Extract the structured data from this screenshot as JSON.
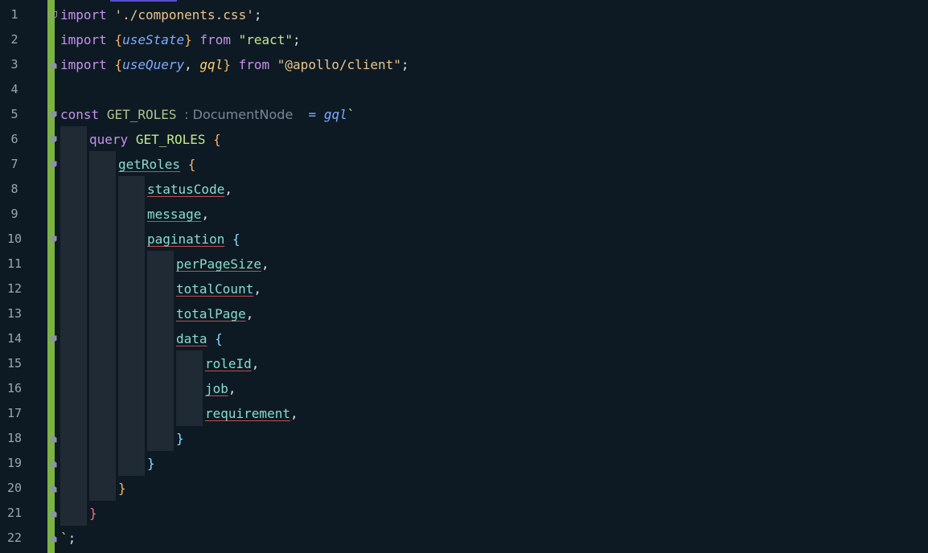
{
  "editor": {
    "line_numbers": [
      "1",
      "2",
      "3",
      "4",
      "5",
      "6",
      "7",
      "8",
      "9",
      "10",
      "11",
      "12",
      "13",
      "14",
      "15",
      "16",
      "17",
      "18",
      "19",
      "20",
      "21",
      "22"
    ],
    "lines": {
      "l1": {
        "kw": "import",
        "str": "'./components.css'",
        "end": ";"
      },
      "l2": {
        "kw": "import",
        "open": "{",
        "name": "useState",
        "close": "}",
        "from": "from",
        "str": "\"react\"",
        "end": ";"
      },
      "l3": {
        "kw": "import",
        "open": "{",
        "name1": "useQuery",
        "sep": ",",
        "name2": "gql",
        "close": "}",
        "from": "from",
        "str": "\"@apollo/client\"",
        "end": ";"
      },
      "l5": {
        "kw": "const",
        "ident": "GET_ROLES",
        "hint": ": DocumentNode",
        "eq": "=",
        "fn": "gql",
        "tick": "`"
      },
      "l6": {
        "kw": "query",
        "name": "GET_ROLES",
        "open": "{"
      },
      "l7": {
        "field": "getRoles",
        "open": "{"
      },
      "l8": {
        "field": "statusCode",
        "end": ","
      },
      "l9": {
        "field": "message",
        "end": ","
      },
      "l10": {
        "field": "pagination",
        "open": "{"
      },
      "l11": {
        "field": "perPageSize",
        "end": ","
      },
      "l12": {
        "field": "totalCount",
        "end": ","
      },
      "l13": {
        "field": "totalPage",
        "end": ","
      },
      "l14": {
        "field": "data",
        "open": "{"
      },
      "l15": {
        "field": "roleId",
        "end": ","
      },
      "l16": {
        "field": "job",
        "end": ","
      },
      "l17": {
        "field": "requirement",
        "end": ","
      },
      "l18": {
        "close": "}"
      },
      "l19": {
        "close": "}"
      },
      "l20": {
        "close": "}"
      },
      "l21": {
        "close": "}"
      },
      "l22": {
        "tick": "`",
        "end": ";"
      }
    }
  }
}
